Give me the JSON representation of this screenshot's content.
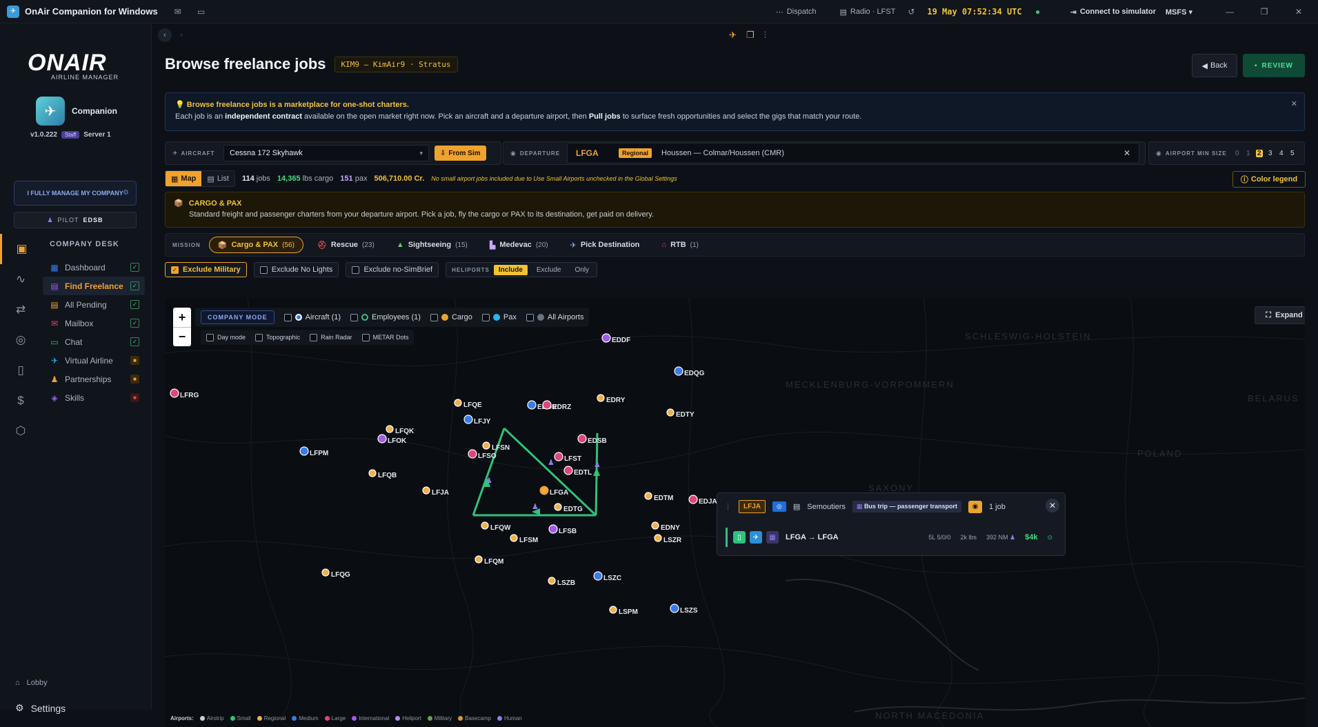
{
  "titlebar": {
    "app_title": "OnAir Companion for Windows",
    "dispatch": "Dispatch",
    "radio": "Radio · LFST",
    "time": "19 May 07:52:34 UTC",
    "connect": "Connect to simulator",
    "sim": "MSFS ▾"
  },
  "sidebar": {
    "logo": "ONAIR",
    "logo_sub": "AIRLINE MANAGER",
    "companion_label": "Companion",
    "version": "v1.0.222",
    "staff_badge": "Staff",
    "server": "Server 1",
    "manage_btn": "I FULLY MANAGE MY COMPANY",
    "pilot_label": "PILOT",
    "pilot_code": "EDSB",
    "desk_title": "COMPANY DESK",
    "items": [
      {
        "label": "Dashboard",
        "icon": "dashboard-icon",
        "state": "check"
      },
      {
        "label": "Find Freelance",
        "icon": "freelance-icon",
        "state": "check"
      },
      {
        "label": "All Pending",
        "icon": "pending-icon",
        "state": "check"
      },
      {
        "label": "Mailbox",
        "icon": "mail-icon",
        "state": "check"
      },
      {
        "label": "Chat",
        "icon": "chat-icon",
        "state": "check"
      },
      {
        "label": "Virtual Airline",
        "icon": "plane-icon",
        "state": "lock"
      },
      {
        "label": "Partnerships",
        "icon": "partners-icon",
        "state": "lock"
      },
      {
        "label": "Skills",
        "icon": "skills-icon",
        "state": "locked-red"
      }
    ],
    "lobby": "Lobby",
    "settings": "Settings"
  },
  "header": {
    "title": "Browse freelance jobs",
    "company_chip": "KIM9 — KimAir9 · Stratus",
    "back": "Back",
    "review": "REVIEW"
  },
  "info": {
    "title": "Browse freelance jobs is a marketplace for one-shot charters.",
    "text_1": "Each job is an ",
    "text_b1": "independent contract",
    "text_2": " available on the open market right now. Pick an aircraft and a departure airport, then ",
    "text_b2": "Pull jobs",
    "text_3": " to surface fresh opportunities and select the gigs that match your route."
  },
  "aircraft": {
    "label": "AIRCRAFT",
    "value": "Cessna 172 Skyhawk",
    "from_sim": "From Sim"
  },
  "departure": {
    "label": "DEPARTURE",
    "icao": "LFGA",
    "class": "Regional",
    "name": "Houssen — Colmar/Houssen (CMR)"
  },
  "min_size": {
    "label": "AIRPORT MIN SIZE",
    "options": [
      "0",
      "1",
      "2",
      "3",
      "4",
      "5"
    ],
    "selected": "2"
  },
  "view": {
    "map": "Map",
    "list": "List",
    "jobs_count": "114",
    "jobs_label": "jobs",
    "cargo": "14,365",
    "cargo_label": "lbs cargo",
    "pax": "151",
    "pax_label": "pax",
    "credits": "506,710.00 Cr.",
    "note": "No small airport jobs included due to Use Small Airports unchecked in the Global Settings",
    "color_legend": "Color legend"
  },
  "cargo_box": {
    "title": "CARGO & PAX",
    "text": "Standard freight and passenger charters from your departure airport. Pick a job, fly the cargo or PAX to its destination, get paid on delivery."
  },
  "mission": {
    "label": "MISSION",
    "tabs": [
      {
        "label": "Cargo & PAX",
        "count": "(56)",
        "icon": "cargo-icon"
      },
      {
        "label": "Rescue",
        "count": "(23)",
        "icon": "rescue-icon"
      },
      {
        "label": "Sightseeing",
        "count": "(15)",
        "icon": "mountain-icon"
      },
      {
        "label": "Medevac",
        "count": "(20)",
        "icon": "medevac-icon"
      },
      {
        "label": "Pick Destination",
        "count": "",
        "icon": "destination-icon"
      },
      {
        "label": "RTB",
        "count": "(1)",
        "icon": "rtb-icon"
      }
    ]
  },
  "filters": {
    "exclude_military": "Exclude Military",
    "exclude_no_lights": "Exclude No Lights",
    "exclude_no_simbrief": "Exclude no-SimBrief",
    "heliports_label": "HELIPORTS",
    "heli_options": [
      "Include",
      "Exclude",
      "Only"
    ]
  },
  "map": {
    "company_mode": "COMPANY MODE",
    "layers": [
      {
        "label": "Aircraft (1)",
        "color": "#ffffff"
      },
      {
        "label": "Employees (1)",
        "color": "#2ec27e"
      },
      {
        "label": "Cargo",
        "color": "#f0a22e"
      },
      {
        "label": "Pax",
        "color": "#2bb5e8"
      },
      {
        "label": "All Airports",
        "color": "#6b7480"
      }
    ],
    "sublayers": [
      "Day mode",
      "Topographic",
      "Rain Radar",
      "METAR Dots"
    ],
    "expand": "Expand",
    "legend_title": "Airports:",
    "legend": [
      {
        "label": "Airstrip",
        "color": "#c9d0da"
      },
      {
        "label": "Small",
        "color": "#2ec27e"
      },
      {
        "label": "Regional",
        "color": "#f0b04a"
      },
      {
        "label": "Medium",
        "color": "#3b7be8"
      },
      {
        "label": "Large",
        "color": "#e0457a"
      },
      {
        "label": "International",
        "color": "#a35be8"
      },
      {
        "label": "Heliport",
        "color": "#b58cf0"
      },
      {
        "label": "Military",
        "color": "#6b9e5a"
      },
      {
        "label": "Basecamp",
        "color": "#d79a3b"
      },
      {
        "label": "Human",
        "color": "#8e7cf0"
      }
    ],
    "airports": [
      {
        "code": "EDDF",
        "type": "International"
      },
      {
        "code": "EDQG",
        "type": "Medium"
      },
      {
        "code": "LFRG",
        "type": "Large"
      },
      {
        "code": "EDRY",
        "type": "Regional"
      },
      {
        "code": "EDTY",
        "type": "Regional"
      },
      {
        "code": "LFQE",
        "type": "Regional"
      },
      {
        "code": "EDDR",
        "type": "Medium"
      },
      {
        "code": "EDRZ",
        "type": "Large"
      },
      {
        "code": "LFJY",
        "type": "Medium"
      },
      {
        "code": "LFQK",
        "type": "Regional"
      },
      {
        "code": "LFOK",
        "type": "International"
      },
      {
        "code": "EDSB",
        "type": "Large"
      },
      {
        "code": "LFSN",
        "type": "Regional"
      },
      {
        "code": "LFPM",
        "type": "Medium"
      },
      {
        "code": "LFSO",
        "type": "Large"
      },
      {
        "code": "LFST",
        "type": "Large"
      },
      {
        "code": "EDTL",
        "type": "Large"
      },
      {
        "code": "LFQB",
        "type": "Regional"
      },
      {
        "code": "LFJA",
        "type": "Regional"
      },
      {
        "code": "LFGA",
        "type": "Regional"
      },
      {
        "code": "EDTM",
        "type": "Regional"
      },
      {
        "code": "EDJA",
        "type": "Large"
      },
      {
        "code": "EDTG",
        "type": "Regional"
      },
      {
        "code": "LFQW",
        "type": "Regional"
      },
      {
        "code": "LFSB",
        "type": "International"
      },
      {
        "code": "EDNY",
        "type": "Regional"
      },
      {
        "code": "LFSM",
        "type": "Regional"
      },
      {
        "code": "LSZR",
        "type": "Regional"
      },
      {
        "code": "LFQM",
        "type": "Regional"
      },
      {
        "code": "LFQG",
        "type": "Regional"
      },
      {
        "code": "LSZC",
        "type": "Medium"
      },
      {
        "code": "LSZB",
        "type": "Regional"
      },
      {
        "code": "LSPM",
        "type": "Regional"
      },
      {
        "code": "LSZS",
        "type": "Medium"
      }
    ],
    "countries": [
      "SCHLESWIG-HOLSTEIN",
      "MECKLENBURG-VORPOMMERN",
      "BELARUS",
      "POLAND",
      "SAXONY",
      "NORTH MACEDONIA"
    ]
  },
  "popup": {
    "icao": "LFJA",
    "operator": "Semoutiers",
    "tag": "Bus trip — passenger transport",
    "jobs": "1 job",
    "route": "LFGA → LFGA",
    "load": "5L 5/0/0",
    "weight": "2k lbs",
    "distance": "392 NM",
    "pay": "$4k"
  }
}
